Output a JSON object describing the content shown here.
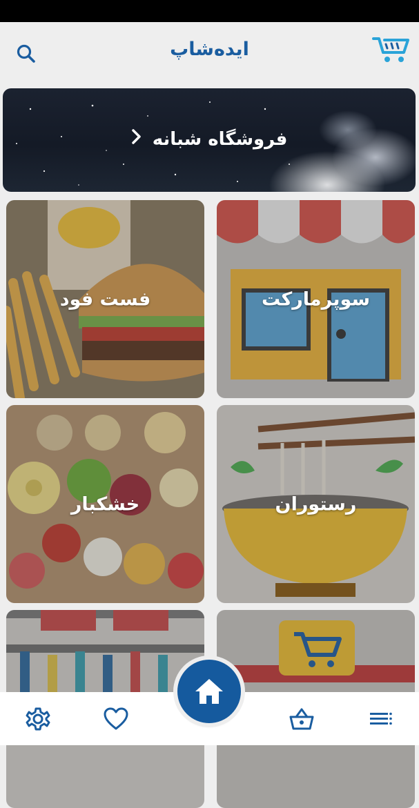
{
  "app": {
    "title": "ایده‌شاپ",
    "accent_color": "#1a5da0",
    "fab_color": "#155a9e"
  },
  "header": {
    "search_icon": "search-icon",
    "logo_icon": "shopping-cart-logo"
  },
  "banner": {
    "label": "فروشگاه شبانه",
    "chevron_icon": "chevron-right-icon"
  },
  "categories": [
    {
      "label": "سوپرمارکت",
      "image": "storefront"
    },
    {
      "label": "فست فود",
      "image": "burger-fries"
    },
    {
      "label": "رستوران",
      "image": "noodle-bowl"
    },
    {
      "label": "خشکبار",
      "image": "dried-fruits"
    },
    {
      "label": "",
      "image": "cart-sign"
    },
    {
      "label": "",
      "image": "pharmacy-shelves"
    }
  ],
  "bottom_nav": {
    "items": [
      {
        "icon": "settings-icon"
      },
      {
        "icon": "heart-icon"
      },
      {
        "icon": "home-icon"
      },
      {
        "icon": "basket-icon"
      },
      {
        "icon": "menu-icon"
      }
    ]
  }
}
